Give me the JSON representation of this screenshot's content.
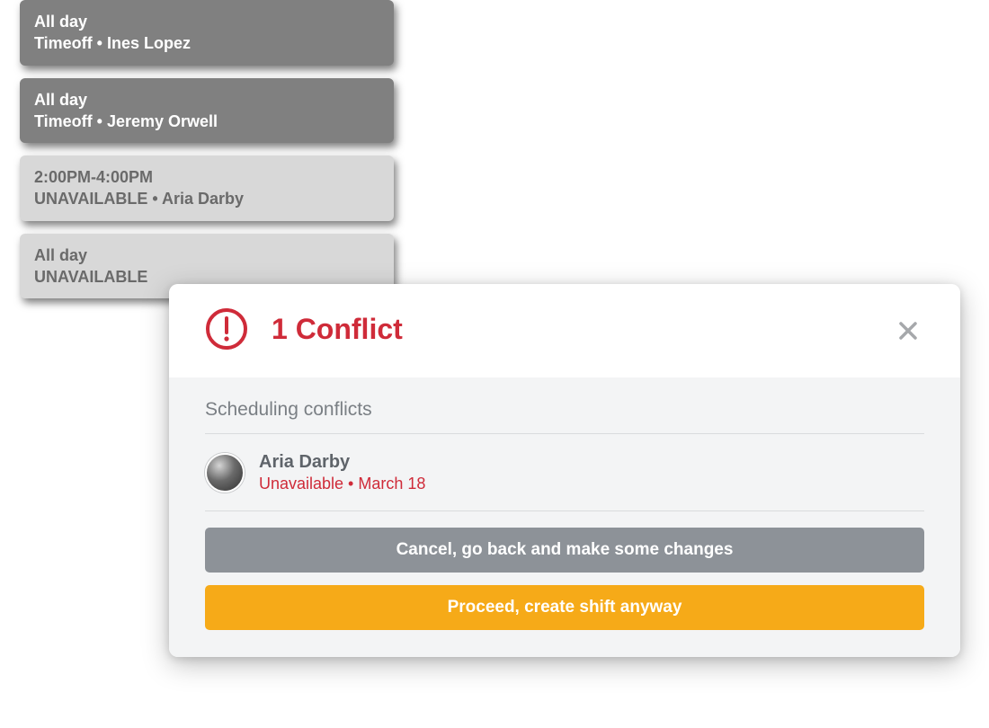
{
  "events": [
    {
      "time": "All day",
      "label": "Timeoff • Ines Lopez",
      "variant": "dark"
    },
    {
      "time": "All day",
      "label": "Timeoff • Jeremy Orwell",
      "variant": "dark"
    },
    {
      "time": "2:00PM-4:00PM",
      "label": "UNAVAILABLE • Aria Darby",
      "variant": "light"
    },
    {
      "time": "All day",
      "label": "UNAVAILABLE",
      "variant": "light"
    }
  ],
  "dialog": {
    "title": "1 Conflict",
    "section_title": "Scheduling conflicts",
    "conflicts": [
      {
        "name": "Aria Darby",
        "reason": "Unavailable • March 18"
      }
    ],
    "cancel_label": "Cancel, go back and make some changes",
    "proceed_label": "Proceed, create shift anyway"
  },
  "colors": {
    "accent_red": "#cf2b39",
    "accent_orange": "#f6aa18"
  }
}
